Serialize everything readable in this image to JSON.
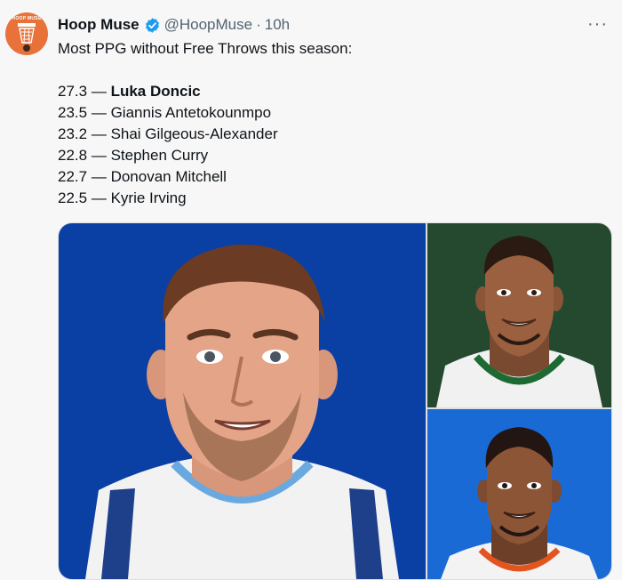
{
  "tweet": {
    "author_name": "Hoop Muse",
    "handle": "@HoopMuse",
    "separator": "·",
    "time": "10h",
    "more_label": "···",
    "avatar_text": "HOOP MUSE",
    "intro": "Most PPG without Free Throws this season:",
    "rankings": [
      {
        "value": "27.3",
        "dash": "—",
        "player": "Luka Doncic"
      },
      {
        "value": "23.5",
        "dash": "—",
        "player": "Giannis Antetokounmpo"
      },
      {
        "value": "23.2",
        "dash": "—",
        "player": "Shai Gilgeous-Alexander"
      },
      {
        "value": "22.8",
        "dash": "—",
        "player": "Stephen Curry"
      },
      {
        "value": "22.7",
        "dash": "—",
        "player": "Donovan Mitchell"
      },
      {
        "value": "22.5",
        "dash": "—",
        "player": "Kyrie Irving"
      }
    ]
  },
  "colors": {
    "avatar_bg": "#e8723a",
    "verified": "#1d9bf0",
    "panel_main_bg": "#0a3fa3",
    "panel_top_right_bg": "#24492e",
    "panel_bottom_right_bg": "#1a6ad6"
  },
  "icons": {
    "verified": "verified-badge-icon",
    "more": "more-horizontal-icon"
  }
}
